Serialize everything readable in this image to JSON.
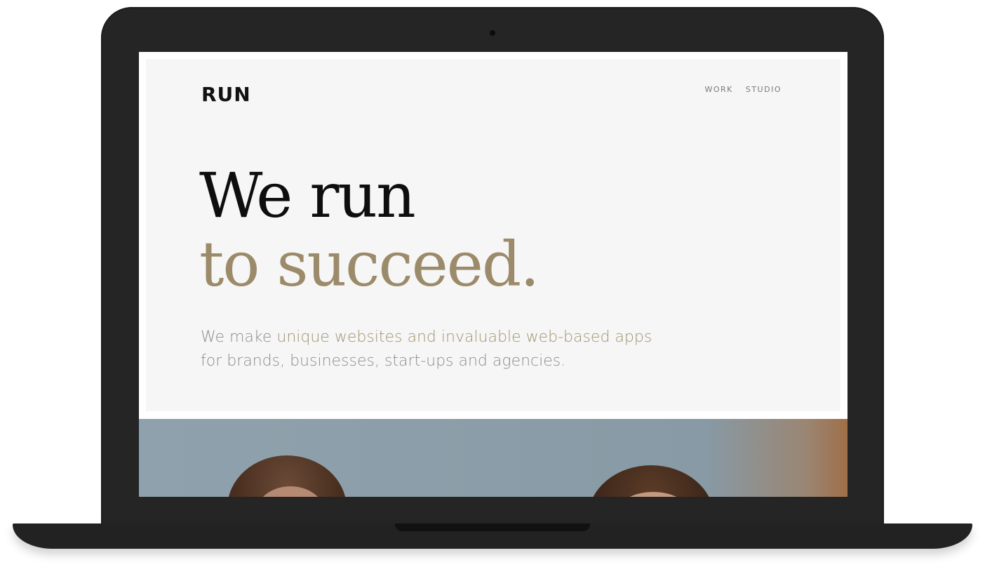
{
  "site": {
    "logo": "RUN",
    "nav": [
      {
        "label": "WORK"
      },
      {
        "label": "STUDIO"
      }
    ]
  },
  "hero": {
    "headline_line1": "We run",
    "headline_line2": "to succeed.",
    "subtext_lead": "We make ",
    "subtext_accent": "unique websites and invaluable web-based apps",
    "subtext_tail": "for brands, businesses, start-ups and agencies."
  },
  "colors": {
    "accent": "#9c8b6a",
    "headline": "#0e0e0e",
    "body_text": "#8c8c8c",
    "hero_background": "#f6f6f6",
    "laptop_frame": "#252525"
  }
}
